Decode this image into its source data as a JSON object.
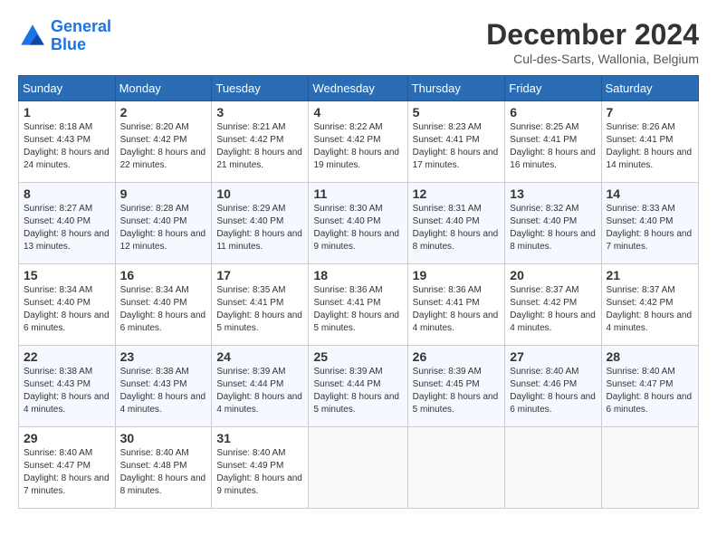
{
  "header": {
    "logo_line1": "General",
    "logo_line2": "Blue",
    "month_title": "December 2024",
    "subtitle": "Cul-des-Sarts, Wallonia, Belgium"
  },
  "weekdays": [
    "Sunday",
    "Monday",
    "Tuesday",
    "Wednesday",
    "Thursday",
    "Friday",
    "Saturday"
  ],
  "weeks": [
    [
      {
        "day": "1",
        "sunrise": "8:18 AM",
        "sunset": "4:43 PM",
        "daylight": "8 hours and 24 minutes."
      },
      {
        "day": "2",
        "sunrise": "8:20 AM",
        "sunset": "4:42 PM",
        "daylight": "8 hours and 22 minutes."
      },
      {
        "day": "3",
        "sunrise": "8:21 AM",
        "sunset": "4:42 PM",
        "daylight": "8 hours and 21 minutes."
      },
      {
        "day": "4",
        "sunrise": "8:22 AM",
        "sunset": "4:42 PM",
        "daylight": "8 hours and 19 minutes."
      },
      {
        "day": "5",
        "sunrise": "8:23 AM",
        "sunset": "4:41 PM",
        "daylight": "8 hours and 17 minutes."
      },
      {
        "day": "6",
        "sunrise": "8:25 AM",
        "sunset": "4:41 PM",
        "daylight": "8 hours and 16 minutes."
      },
      {
        "day": "7",
        "sunrise": "8:26 AM",
        "sunset": "4:41 PM",
        "daylight": "8 hours and 14 minutes."
      }
    ],
    [
      {
        "day": "8",
        "sunrise": "8:27 AM",
        "sunset": "4:40 PM",
        "daylight": "8 hours and 13 minutes."
      },
      {
        "day": "9",
        "sunrise": "8:28 AM",
        "sunset": "4:40 PM",
        "daylight": "8 hours and 12 minutes."
      },
      {
        "day": "10",
        "sunrise": "8:29 AM",
        "sunset": "4:40 PM",
        "daylight": "8 hours and 11 minutes."
      },
      {
        "day": "11",
        "sunrise": "8:30 AM",
        "sunset": "4:40 PM",
        "daylight": "8 hours and 9 minutes."
      },
      {
        "day": "12",
        "sunrise": "8:31 AM",
        "sunset": "4:40 PM",
        "daylight": "8 hours and 8 minutes."
      },
      {
        "day": "13",
        "sunrise": "8:32 AM",
        "sunset": "4:40 PM",
        "daylight": "8 hours and 8 minutes."
      },
      {
        "day": "14",
        "sunrise": "8:33 AM",
        "sunset": "4:40 PM",
        "daylight": "8 hours and 7 minutes."
      }
    ],
    [
      {
        "day": "15",
        "sunrise": "8:34 AM",
        "sunset": "4:40 PM",
        "daylight": "8 hours and 6 minutes."
      },
      {
        "day": "16",
        "sunrise": "8:34 AM",
        "sunset": "4:40 PM",
        "daylight": "8 hours and 6 minutes."
      },
      {
        "day": "17",
        "sunrise": "8:35 AM",
        "sunset": "4:41 PM",
        "daylight": "8 hours and 5 minutes."
      },
      {
        "day": "18",
        "sunrise": "8:36 AM",
        "sunset": "4:41 PM",
        "daylight": "8 hours and 5 minutes."
      },
      {
        "day": "19",
        "sunrise": "8:36 AM",
        "sunset": "4:41 PM",
        "daylight": "8 hours and 4 minutes."
      },
      {
        "day": "20",
        "sunrise": "8:37 AM",
        "sunset": "4:42 PM",
        "daylight": "8 hours and 4 minutes."
      },
      {
        "day": "21",
        "sunrise": "8:37 AM",
        "sunset": "4:42 PM",
        "daylight": "8 hours and 4 minutes."
      }
    ],
    [
      {
        "day": "22",
        "sunrise": "8:38 AM",
        "sunset": "4:43 PM",
        "daylight": "8 hours and 4 minutes."
      },
      {
        "day": "23",
        "sunrise": "8:38 AM",
        "sunset": "4:43 PM",
        "daylight": "8 hours and 4 minutes."
      },
      {
        "day": "24",
        "sunrise": "8:39 AM",
        "sunset": "4:44 PM",
        "daylight": "8 hours and 4 minutes."
      },
      {
        "day": "25",
        "sunrise": "8:39 AM",
        "sunset": "4:44 PM",
        "daylight": "8 hours and 5 minutes."
      },
      {
        "day": "26",
        "sunrise": "8:39 AM",
        "sunset": "4:45 PM",
        "daylight": "8 hours and 5 minutes."
      },
      {
        "day": "27",
        "sunrise": "8:40 AM",
        "sunset": "4:46 PM",
        "daylight": "8 hours and 6 minutes."
      },
      {
        "day": "28",
        "sunrise": "8:40 AM",
        "sunset": "4:47 PM",
        "daylight": "8 hours and 6 minutes."
      }
    ],
    [
      {
        "day": "29",
        "sunrise": "8:40 AM",
        "sunset": "4:47 PM",
        "daylight": "8 hours and 7 minutes."
      },
      {
        "day": "30",
        "sunrise": "8:40 AM",
        "sunset": "4:48 PM",
        "daylight": "8 hours and 8 minutes."
      },
      {
        "day": "31",
        "sunrise": "8:40 AM",
        "sunset": "4:49 PM",
        "daylight": "8 hours and 9 minutes."
      },
      null,
      null,
      null,
      null
    ]
  ]
}
